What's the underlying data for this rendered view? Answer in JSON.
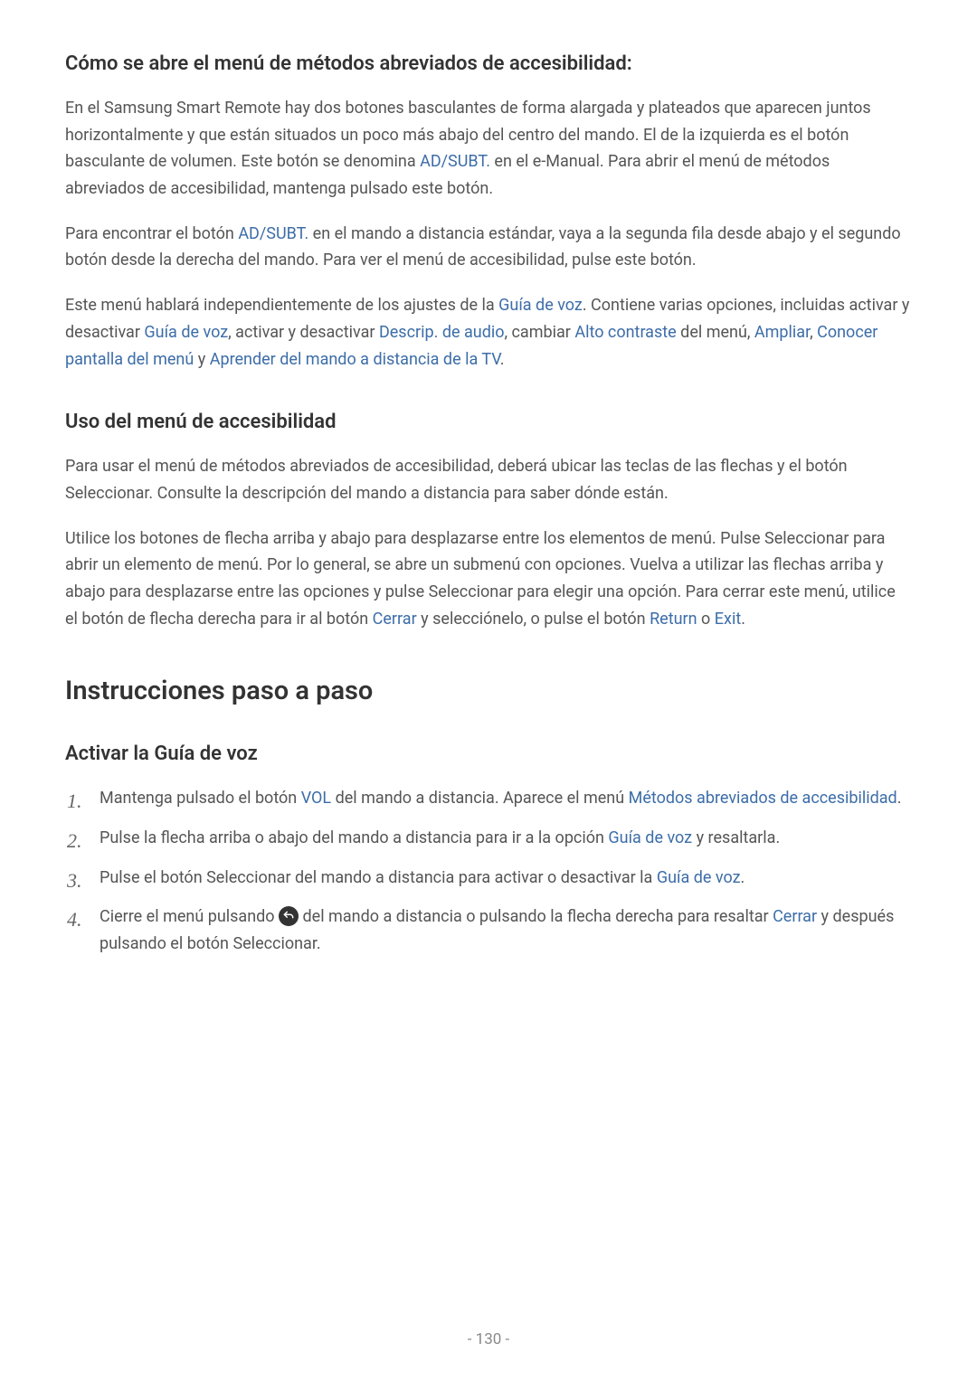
{
  "sections": {
    "s1": {
      "heading": "Cómo se abre el menú de métodos abreviados de accesibilidad:",
      "p1_a": "En el Samsung Smart Remote hay dos botones basculantes de forma alargada y plateados que aparecen juntos horizontalmente y que están situados un poco más abajo del centro del mando. El de la izquierda es el botón basculante de volumen. Este botón se denomina ",
      "p1_t1": "AD/SUBT.",
      "p1_b": " en el e-Manual. Para abrir el menú de métodos abreviados de accesibilidad, mantenga pulsado este botón.",
      "p2_a": "Para encontrar el botón ",
      "p2_t1": "AD/SUBT.",
      "p2_b": " en el mando a distancia estándar, vaya a la segunda fila desde abajo y el segundo botón desde la derecha del mando. Para ver el menú de accesibilidad, pulse este botón.",
      "p3_a": "Este menú hablará independientemente de los ajustes de la ",
      "p3_t1": "Guía de voz",
      "p3_b": ". Contiene varias opciones, incluidas activar y desactivar ",
      "p3_t2": "Guía de voz",
      "p3_c": ", activar y desactivar ",
      "p3_t3": "Descrip. de audio",
      "p3_d": ", cambiar ",
      "p3_t4": "Alto contraste",
      "p3_e": " del menú, ",
      "p3_t5": "Ampliar",
      "p3_f": ", ",
      "p3_t6": "Conocer pantalla del menú",
      "p3_g": " y ",
      "p3_t7": "Aprender del mando a distancia de la TV",
      "p3_h": "."
    },
    "s2": {
      "heading": "Uso del menú de accesibilidad",
      "p1": "Para usar el menú de métodos abreviados de accesibilidad, deberá ubicar las teclas de las flechas y el botón Seleccionar. Consulte la descripción del mando a distancia para saber dónde están.",
      "p2_a": "Utilice los botones de flecha arriba y abajo para desplazarse entre los elementos de menú. Pulse Seleccionar para abrir un elemento de menú. Por lo general, se abre un submenú con opciones. Vuelva a utilizar las flechas arriba y abajo para desplazarse entre las opciones y pulse Seleccionar para elegir una opción. Para cerrar este menú, utilice el botón de flecha derecha para ir al botón ",
      "p2_t1": "Cerrar",
      "p2_b": " y selecciónelo, o pulse el botón ",
      "p2_t2": "Return",
      "p2_c": " o ",
      "p2_t3": "Exit",
      "p2_d": "."
    },
    "s3": {
      "major_heading": "Instrucciones paso a paso",
      "sub_heading": "Activar la Guía de voz",
      "li1_a": "Mantenga pulsado el botón ",
      "li1_t1": "VOL",
      "li1_b": " del mando a distancia. Aparece el menú ",
      "li1_t2": "Métodos abreviados de accesibilidad",
      "li1_c": ".",
      "li2_a": "Pulse la flecha arriba o abajo del mando a distancia para ir a la opción ",
      "li2_t1": "Guía de voz",
      "li2_b": " y resaltarla.",
      "li3_a": "Pulse el botón Seleccionar del mando a distancia para activar o desactivar la ",
      "li3_t1": "Guía de voz",
      "li3_b": ".",
      "li4_a": "Cierre el menú pulsando ",
      "li4_b": " del mando a distancia o pulsando la flecha derecha para resaltar ",
      "li4_t1": "Cerrar",
      "li4_c": " y después pulsando el botón Seleccionar."
    }
  },
  "footer": {
    "page": "- 130 -"
  }
}
